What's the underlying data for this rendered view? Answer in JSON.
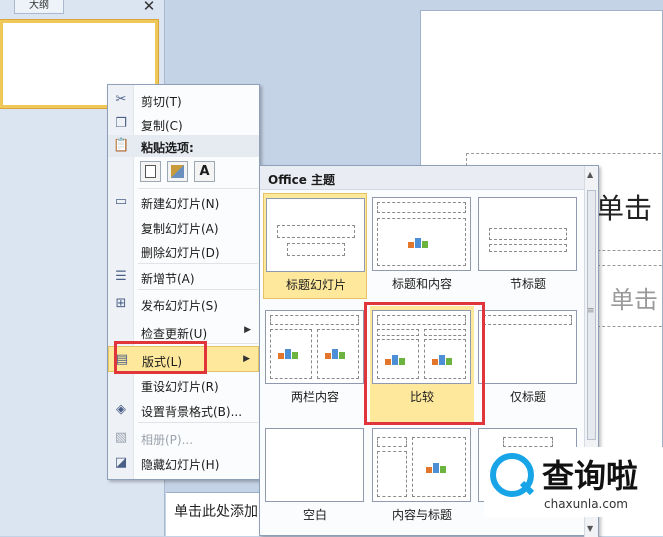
{
  "outline_pane": {
    "tab_label": "大纲",
    "close_glyph": "✕"
  },
  "slide": {
    "title_placeholder": "单击",
    "subtitle_placeholder": "单击"
  },
  "notes": {
    "text": "单击此处添加"
  },
  "context_menu": {
    "items": [
      {
        "label": "剪切(T)",
        "icon": "cut-icon"
      },
      {
        "label": "复制(C)",
        "icon": "copy-icon"
      },
      {
        "label": "粘贴选项:",
        "icon": "paste-icon"
      },
      {
        "label": "新建幻灯片(N)",
        "icon": "new-slide-icon"
      },
      {
        "label": "复制幻灯片(A)",
        "icon": ""
      },
      {
        "label": "删除幻灯片(D)",
        "icon": ""
      },
      {
        "label": "新增节(A)",
        "icon": "add-section-icon"
      },
      {
        "label": "发布幻灯片(S)",
        "icon": "publish-slides-icon"
      },
      {
        "label": "检查更新(U)",
        "icon": ""
      },
      {
        "label": "版式(L)",
        "icon": "layout-icon"
      },
      {
        "label": "重设幻灯片(R)",
        "icon": ""
      },
      {
        "label": "设置背景格式(B)...",
        "icon": "background-format-icon"
      },
      {
        "label": "相册(P)...",
        "icon": "photo-album-icon"
      },
      {
        "label": "隐藏幻灯片(H)",
        "icon": "hide-slide-icon"
      }
    ],
    "paste_buttons": [
      "",
      "",
      "A"
    ]
  },
  "layout_gallery": {
    "header": "Office 主题",
    "layouts": [
      {
        "caption": "标题幻灯片"
      },
      {
        "caption": "标题和内容"
      },
      {
        "caption": "节标题"
      },
      {
        "caption": "两栏内容"
      },
      {
        "caption": "比较"
      },
      {
        "caption": "仅标题"
      },
      {
        "caption": "空白"
      },
      {
        "caption": "内容与标题"
      },
      {
        "caption": ""
      }
    ]
  },
  "watermark": {
    "brand": "查询啦",
    "domain": "chaxunla.com"
  },
  "colors": {
    "highlight": "#e0353a",
    "selected": "#fde89c",
    "accent": "#18a5e8"
  }
}
